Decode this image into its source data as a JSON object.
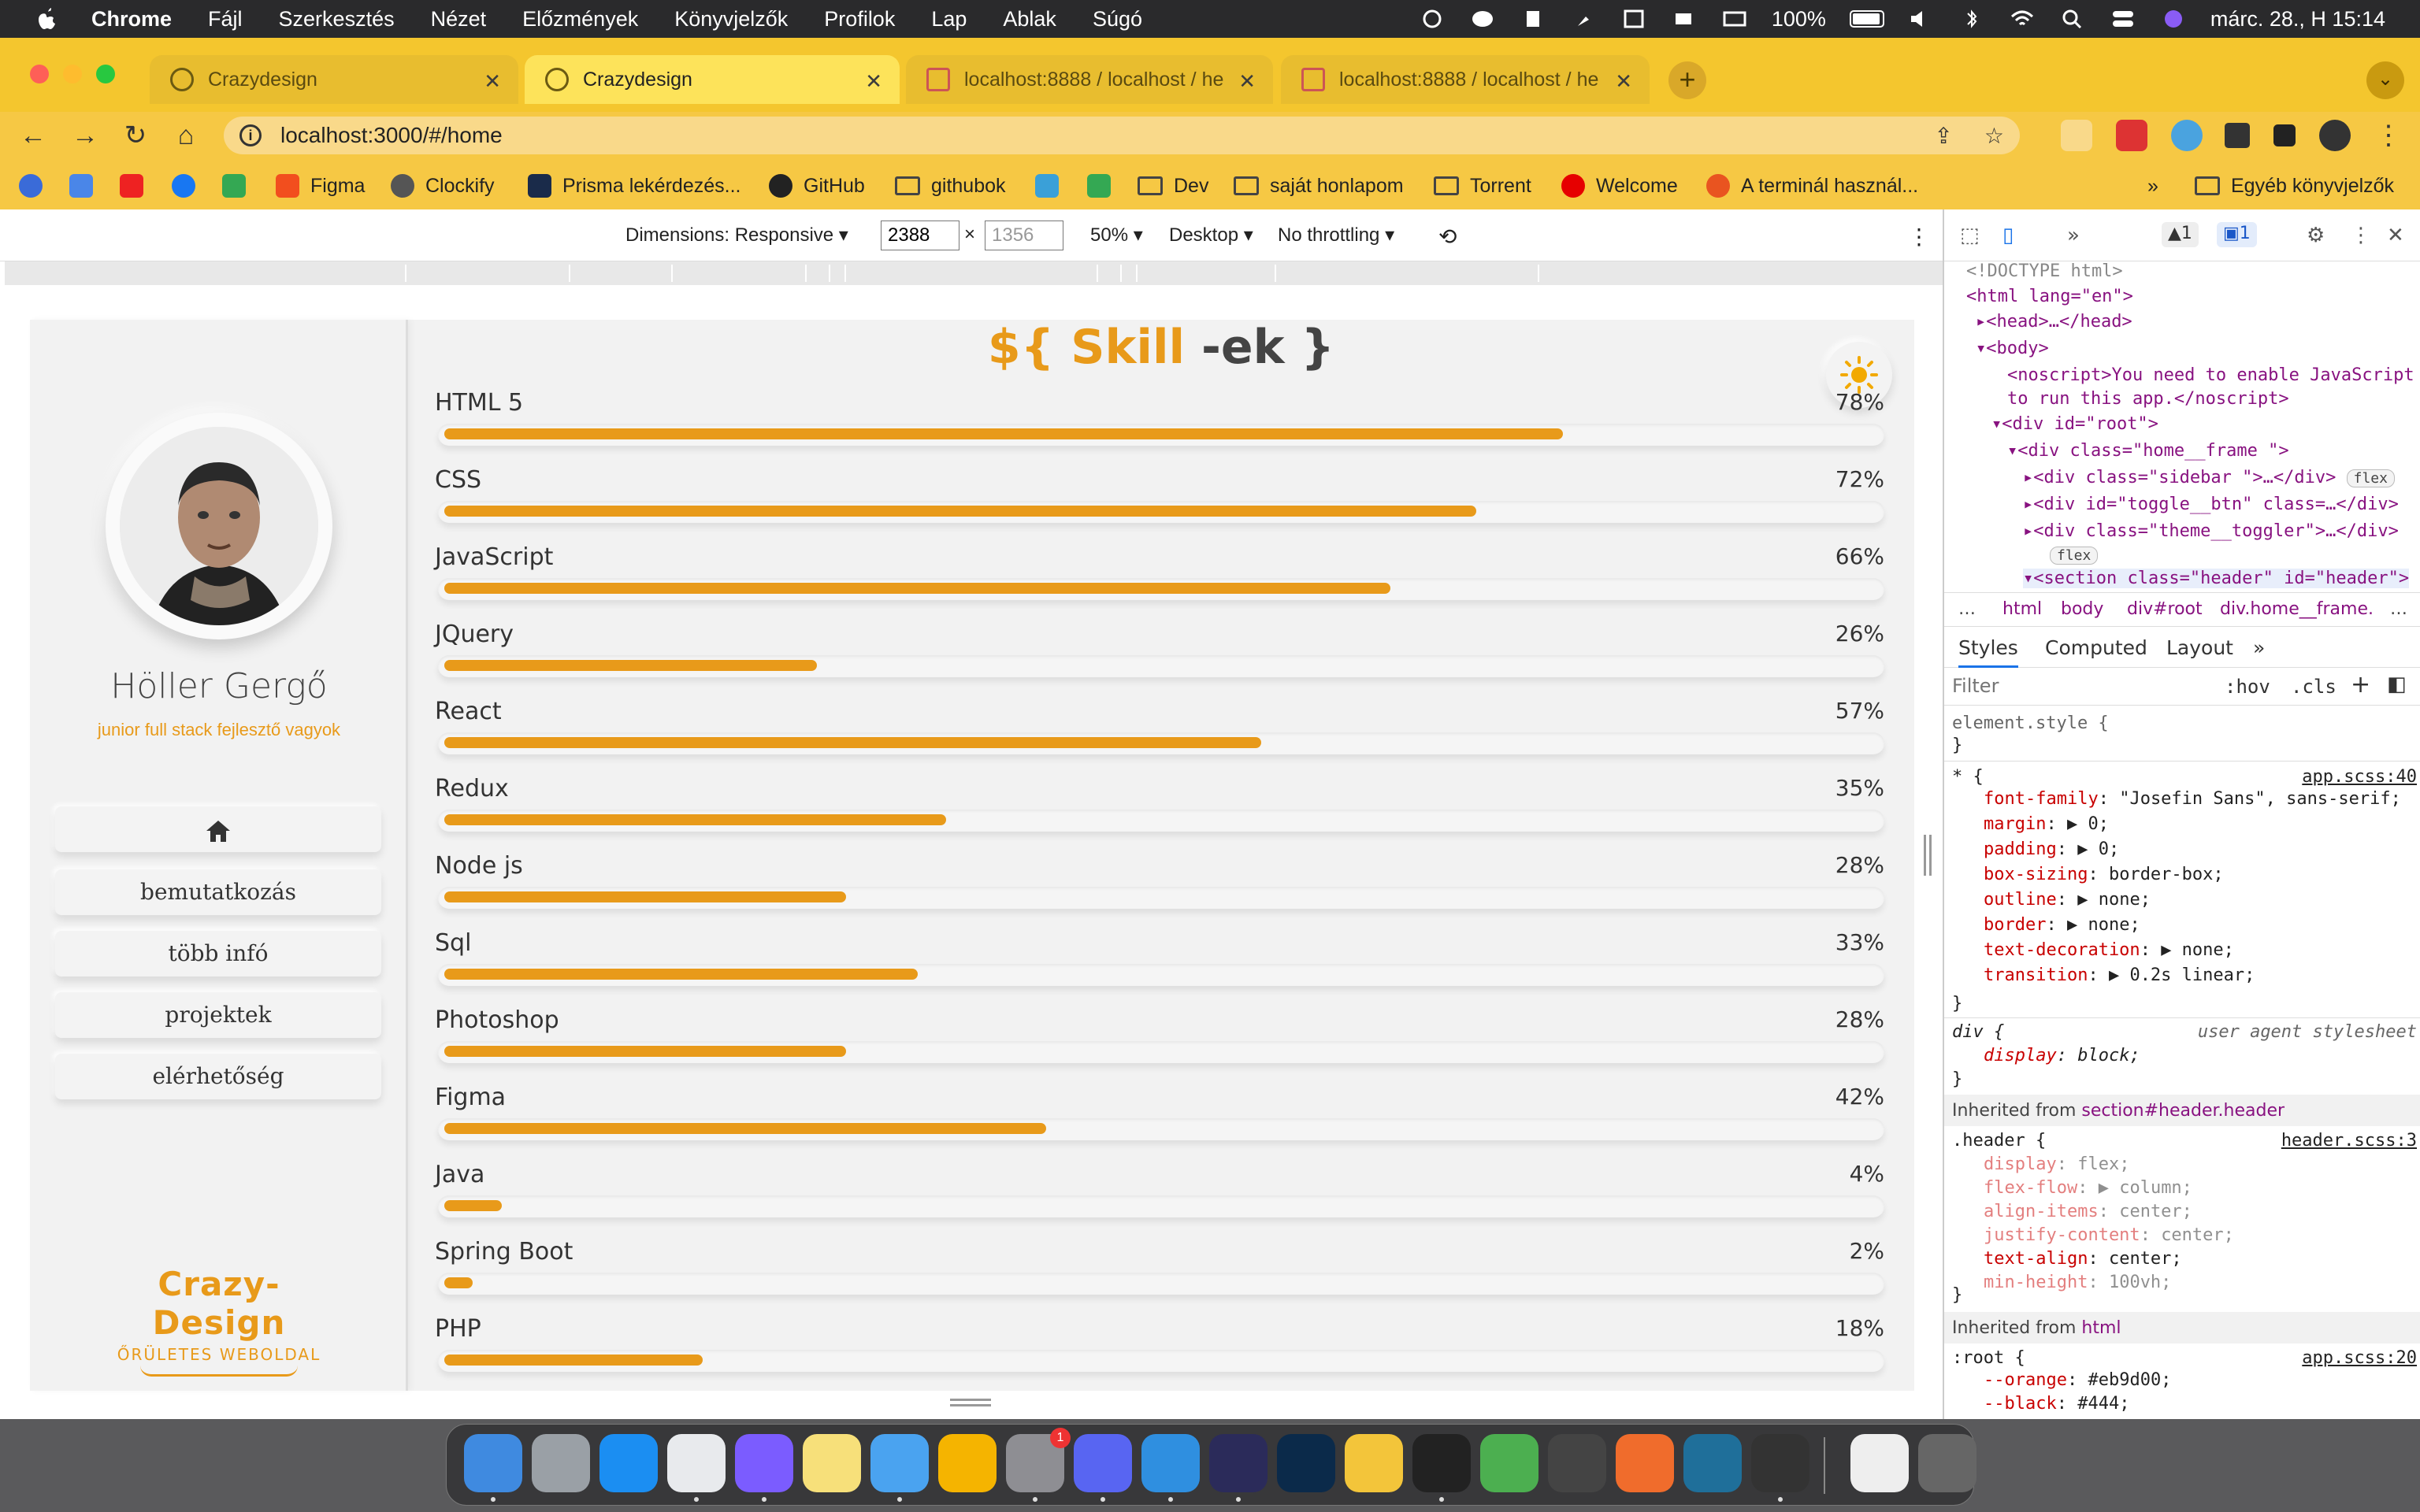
{
  "menubar": {
    "app": "Chrome",
    "items": [
      "Fájl",
      "Szerkesztés",
      "Nézet",
      "Előzmények",
      "Könyvjelzők",
      "Profilok",
      "Lap",
      "Ablak",
      "Súgó"
    ],
    "battery": "100%",
    "datetime": "márc. 28., H 15:14"
  },
  "tabs": [
    {
      "title": "Crazydesign",
      "active": false
    },
    {
      "title": "Crazydesign",
      "active": true
    },
    {
      "title": "localhost:8888 / localhost / he",
      "active": false
    },
    {
      "title": "localhost:8888 / localhost / he",
      "active": false
    }
  ],
  "address": {
    "url": "localhost:3000/#/home"
  },
  "bookmarks": [
    "Figma",
    "Clockify",
    "Prisma lekérdezés...",
    "GitHub",
    "githubok",
    "Dev",
    "saját honlapom",
    "Torrent",
    "Welcome",
    "A terminál használ...",
    "Egyéb könyvjelzők"
  ],
  "device_toolbar": {
    "dimensions": "Dimensions: Responsive",
    "width": "2388",
    "height": "1356",
    "times": "×",
    "zoom": "50%",
    "device": "Desktop",
    "throttle": "No throttling"
  },
  "site": {
    "title_accent": "${ Skill",
    "title_dark": " -ek }",
    "person_name": "Höller Gergő",
    "person_role": "junior full stack fejlesztő vagyok",
    "nav": [
      "bemutatkozás",
      "több infó",
      "projektek",
      "elérhetőség"
    ],
    "logo_main": "Crazy-Design",
    "logo_sub": "ŐRÜLETES WEBOLDAL",
    "accent_color": "#e89a1a",
    "skills": [
      {
        "name": "HTML 5",
        "percent": 78,
        "label": "78%"
      },
      {
        "name": "CSS",
        "percent": 72,
        "label": "72%"
      },
      {
        "name": "JavaScript",
        "percent": 66,
        "label": "66%"
      },
      {
        "name": "JQuery",
        "percent": 26,
        "label": "26%"
      },
      {
        "name": "React",
        "percent": 57,
        "label": "57%"
      },
      {
        "name": "Redux",
        "percent": 35,
        "label": "35%"
      },
      {
        "name": "Node js",
        "percent": 28,
        "label": "28%"
      },
      {
        "name": "Sql",
        "percent": 33,
        "label": "33%"
      },
      {
        "name": "Photoshop",
        "percent": 28,
        "label": "28%"
      },
      {
        "name": "Figma",
        "percent": 42,
        "label": "42%"
      },
      {
        "name": "Java",
        "percent": 4,
        "label": "4%"
      },
      {
        "name": "Spring Boot",
        "percent": 2,
        "label": "2%"
      },
      {
        "name": "PHP",
        "percent": 18,
        "label": "18%"
      }
    ]
  },
  "devtools": {
    "warn_count": "1",
    "msg_count": "1",
    "dom": {
      "doctype": "<!DOCTYPE html>",
      "html_open": "<html lang=\"en\">",
      "head": "<head>…</head>",
      "body": "<body>",
      "noscript": "<noscript>You need to enable JavaScript",
      "noscript2": "to run this app.</noscript>",
      "root": "<div id=\"root\">",
      "home_frame": "<div class=\"home__frame \">",
      "sidebar": "<div class=\"sidebar \">…</div>",
      "toggle": "<div id=\"toggle__btn\" class=…</div>",
      "theme": "<div class=\"theme__toggler\">…</div>",
      "section": "<section class=\"header\" id=\"header\">",
      "flex": "flex"
    },
    "crumbs": [
      "…",
      "html",
      "body",
      "div#root",
      "div.home__frame.",
      "…"
    ],
    "tabs": [
      "Styles",
      "Computed",
      "Layout",
      "»"
    ],
    "filter_placeholder": "Filter",
    "hov": ":hov",
    "cls": ".cls",
    "element_style": "element.style {",
    "close_brace": "}",
    "rule1_selector": "* {",
    "rule1_source": "app.scss:40",
    "rule1_props": [
      {
        "p": "font-family",
        "v": "\"Josefin Sans\", sans-serif;"
      },
      {
        "p": "margin",
        "v": "▶ 0;"
      },
      {
        "p": "padding",
        "v": "▶ 0;"
      },
      {
        "p": "box-sizing",
        "v": "border-box;"
      },
      {
        "p": "outline",
        "v": "▶ none;"
      },
      {
        "p": "border",
        "v": "▶ none;"
      },
      {
        "p": "text-decoration",
        "v": "▶ none;"
      },
      {
        "p": "transition",
        "v": "▶ 0.2s linear;"
      }
    ],
    "rule2_selector": "div {",
    "rule2_source": "user agent stylesheet",
    "rule2_prop": "display",
    "rule2_val": "block;",
    "inherited1_prefix": "Inherited from ",
    "inherited1": "section#header.header",
    "rule3_selector": ".header {",
    "rule3_source": "header.scss:3",
    "rule3_props": [
      {
        "p": "display",
        "v": "flex;"
      },
      {
        "p": "flex-flow",
        "v": "▶ column;"
      },
      {
        "p": "align-items",
        "v": "center;"
      },
      {
        "p": "justify-content",
        "v": "center;"
      },
      {
        "p": "text-align",
        "v": "center;"
      },
      {
        "p": "min-height",
        "v": "100vh;"
      }
    ],
    "inherited2_prefix": "Inherited from ",
    "inherited2": "html",
    "rule4_selector": ":root {",
    "rule4_source": "app.scss:20",
    "rule4_props": [
      {
        "p": "--orange",
        "v": "#eb9d00;"
      },
      {
        "p": "--black",
        "v": "#444;"
      }
    ]
  },
  "dock": {
    "apps": [
      "Finder",
      "Launchpad",
      "App Store",
      "Chrome",
      "Messenger",
      "Notes",
      "Mail",
      "Photos",
      "System Preferences",
      "Discord",
      "VS Code",
      "Unknown",
      "Photoshop",
      "Files",
      "IntelliJ IDEA",
      "Maps",
      "TablePlus",
      "Pen",
      "MySQL Workbench",
      "Final Cut",
      "Document",
      "Trash"
    ],
    "badge": "1"
  }
}
